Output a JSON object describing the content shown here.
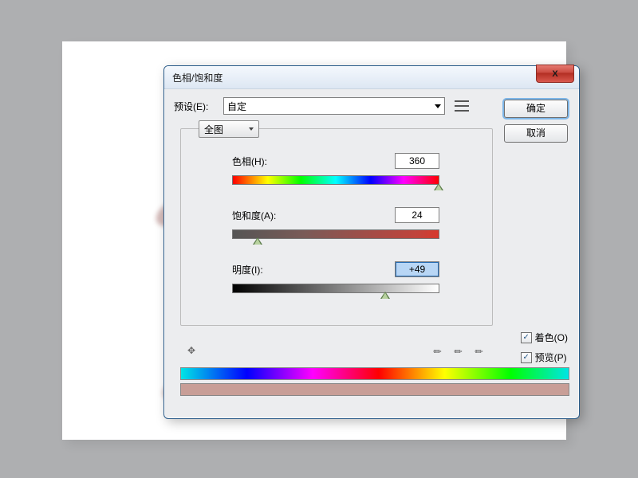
{
  "dialog": {
    "title": "色相/饱和度",
    "close_glyph": "X",
    "preset_label": "预设(E):",
    "preset_value": "自定",
    "ok_label": "确定",
    "cancel_label": "取消",
    "channel_value": "全图",
    "sliders": {
      "hue": {
        "label": "色相(H):",
        "value": "360",
        "pos_pct": 100
      },
      "sat": {
        "label": "饱和度(A):",
        "value": "24",
        "pos_pct": 12
      },
      "lig": {
        "label": "明度(I):",
        "value": "+49",
        "pos_pct": 74,
        "selected": true
      }
    },
    "colorize_label": "着色(O)",
    "preview_label": "预览(P)",
    "colorize_checked": true,
    "preview_checked": true
  }
}
